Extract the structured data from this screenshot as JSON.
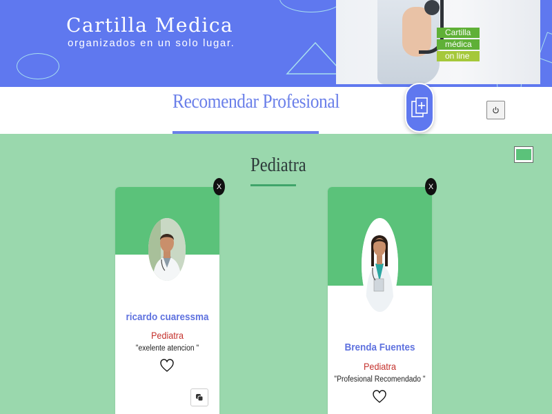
{
  "banner": {
    "title": "Cartilla Medica",
    "subtitle": "organizados en un solo lugar.",
    "photo_badge": [
      "Cartilla",
      "médica",
      "on line"
    ]
  },
  "nav": {
    "title": "Recomendar Profesional",
    "add_icon": "add-files-icon",
    "logout_icon": "power-icon"
  },
  "section": {
    "title": "Pediatra",
    "view_toggle_icon": "view-toggle-icon"
  },
  "cards": [
    {
      "name": "ricardo cuaressma",
      "specialty": "Pediatra",
      "comment": "\"exelente atencion \"",
      "close_label": "X",
      "favorite_icon": "heart-outline-icon",
      "action_icon": "copy-icon"
    },
    {
      "name": "Brenda Fuentes",
      "specialty": "Pediatra",
      "comment": "\"Profesional Recomendado \"",
      "close_label": "X",
      "favorite_icon": "heart-outline-icon"
    }
  ],
  "colors": {
    "banner_bg": "#5f78ef",
    "page_bg": "#9ad8ad",
    "card_header": "#5bc27a",
    "name_color": "#5f72df",
    "specialty_color": "#c4302b",
    "accent_blue": "#6a7fe9"
  }
}
